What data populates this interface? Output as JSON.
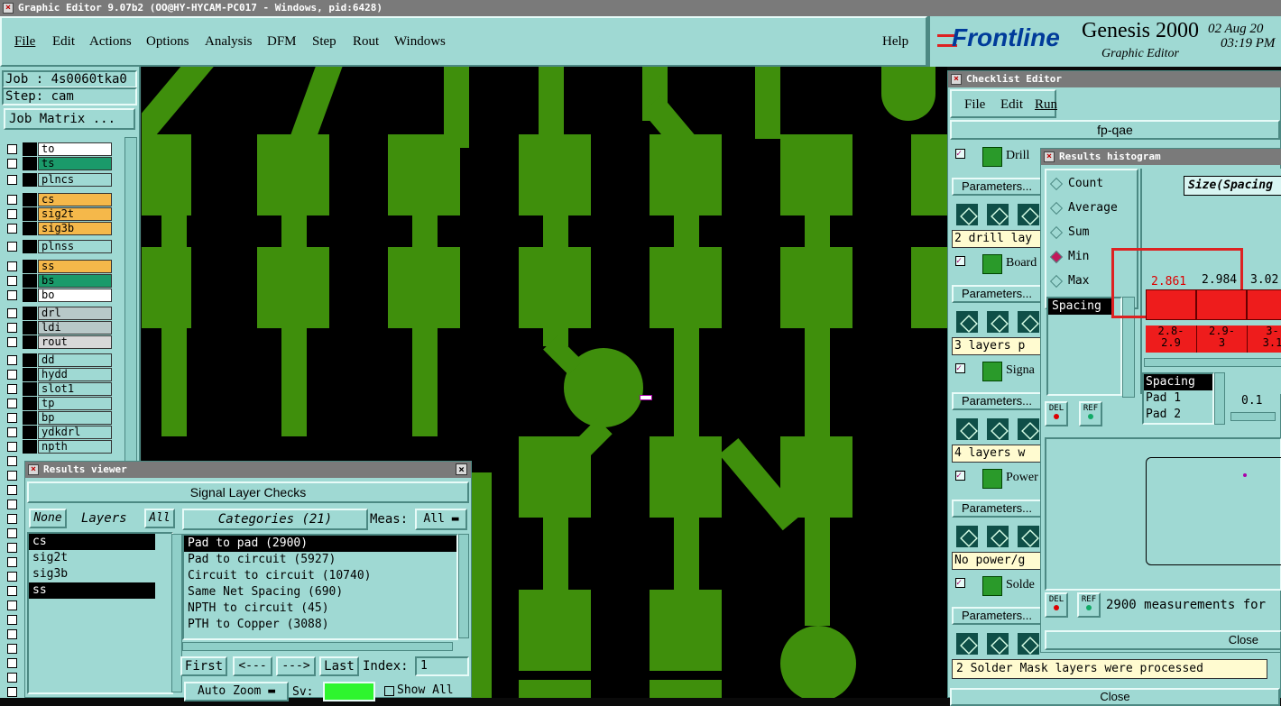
{
  "window": {
    "title": "Graphic Editor 9.07b2 (OO@HY-HYCAM-PC017 - Windows, pid:6428)"
  },
  "menu": [
    "File",
    "Edit",
    "Actions",
    "Options",
    "Analysis",
    "DFM",
    "Step",
    "Rout",
    "Windows"
  ],
  "help": "Help",
  "brand": {
    "logo": "Frontline",
    "product": "Genesis 2000",
    "subtitle": "Graphic Editor",
    "date": "02 Aug 20",
    "time": "03:19 PM"
  },
  "job": {
    "job_label": "Job : 4s0060tka0",
    "step_label": "Step: cam",
    "matrix_button": "Job Matrix ..."
  },
  "layers": [
    {
      "name": "to",
      "color": "#ffffff"
    },
    {
      "name": "ts",
      "color": "#1a9a6a"
    },
    {
      "name": "plncs",
      "color": "#9fd9d3"
    },
    {
      "name": "cs",
      "color": "#f5b84a"
    },
    {
      "name": "sig2t",
      "color": "#f5b84a"
    },
    {
      "name": "sig3b",
      "color": "#f5b84a"
    },
    {
      "name": "plnss",
      "color": "#9fd9d3"
    },
    {
      "name": "ss",
      "color": "#f5b84a"
    },
    {
      "name": "bs",
      "color": "#1a9a6a"
    },
    {
      "name": "bo",
      "color": "#ffffff"
    },
    {
      "name": "drl",
      "color": "#b8c8c8"
    },
    {
      "name": "ldi",
      "color": "#b8c8c8"
    },
    {
      "name": "rout",
      "color": "#d8d8d8"
    },
    {
      "name": "dd",
      "color": "#9fd9d3"
    },
    {
      "name": "hydd",
      "color": "#9fd9d3"
    },
    {
      "name": "slot1",
      "color": "#9fd9d3"
    },
    {
      "name": "tp",
      "color": "#9fd9d3"
    },
    {
      "name": "bp",
      "color": "#9fd9d3"
    },
    {
      "name": "ydkdrl",
      "color": "#9fd9d3"
    },
    {
      "name": "npth",
      "color": "#9fd9d3"
    }
  ],
  "results_viewer": {
    "title": "Results viewer",
    "header": "Signal Layer Checks",
    "none_btn": "None",
    "layers_label": "Layers",
    "all_btn": "All",
    "categories_label": "Categories (21)",
    "meas_label": "Meas:",
    "meas_value": "All",
    "layer_list": [
      "cs",
      "sig2t",
      "sig3b",
      "ss"
    ],
    "categories": [
      "Pad to pad (2900)",
      "Pad to circuit (5927)",
      "Circuit to circuit (10740)",
      "Same Net Spacing (690)",
      "NPTH to circuit (45)",
      "PTH to Copper (3088)"
    ],
    "first": "First",
    "prev": "<---",
    "next": "--->",
    "last": "Last",
    "index_label": "Index:",
    "index_value": "1",
    "auto_zoom": "Auto Zoom",
    "sv_label": "Sv:",
    "show_all": "Show All"
  },
  "checklist": {
    "title": "Checklist Editor",
    "menu": [
      "File",
      "Edit",
      "Run"
    ],
    "name": "fp-qae",
    "items": [
      {
        "label": "Drill",
        "status": "2 drill lay"
      },
      {
        "label": "Board",
        "status": "3 layers p"
      },
      {
        "label": "Signa",
        "status": "4 layers w"
      },
      {
        "label": "Power",
        "status": "No power/g"
      },
      {
        "label": "Solde",
        "status": "2 Solder Mask layers were processed"
      }
    ],
    "params_label": "Parameters...",
    "close": "Close"
  },
  "histogram": {
    "title": "Results histogram",
    "modes": [
      "Count",
      "Average",
      "Sum",
      "Min",
      "Max"
    ],
    "selected_mode": "Min",
    "list_selected": "Spacing",
    "size_label": "Size(Spacing",
    "bar_values": [
      "2.861",
      "2.984",
      "3.02"
    ],
    "ranges": [
      "2.8-\n2.9",
      "2.9-\n3",
      "3-\n3.1"
    ],
    "meas_list": [
      "Spacing",
      "Pad 1",
      "Pad 2"
    ],
    "step_value": "0.1",
    "del": "DEL",
    "ref": "REF",
    "summary": "2900 measurements for",
    "close": "Close"
  }
}
